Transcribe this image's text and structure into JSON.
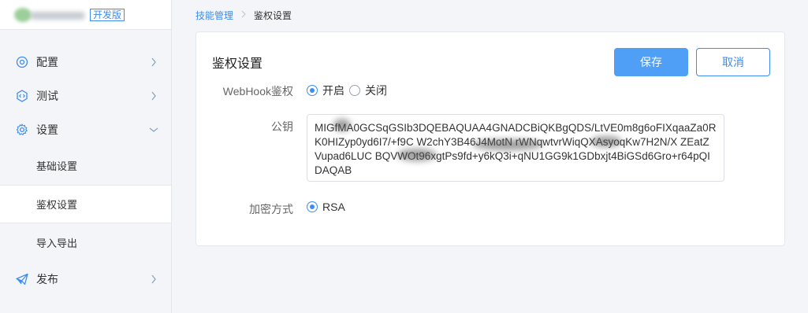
{
  "app": {
    "dev_tag": "开发版"
  },
  "sidebar": {
    "items": [
      {
        "label": "配置",
        "icon": "settings-dial-icon"
      },
      {
        "label": "测试",
        "icon": "code-shield-icon"
      },
      {
        "label": "设置",
        "icon": "gear-icon",
        "expanded": true,
        "children": [
          "基础设置",
          "鉴权设置",
          "导入导出"
        ],
        "active_child": "鉴权设置"
      },
      {
        "label": "发布",
        "icon": "paper-plane-icon"
      }
    ]
  },
  "breadcrumb": {
    "parent": "技能管理",
    "current": "鉴权设置"
  },
  "form": {
    "title": "鉴权设置",
    "save_label": "保存",
    "cancel_label": "取消",
    "webhook": {
      "label": "WebHook鉴权",
      "options": [
        "开启",
        "关闭"
      ],
      "selected": "开启"
    },
    "public_key": {
      "label": "公钥",
      "value": "MIGfMA0GCSqGSIb3DQEBAQUAA4GNADCBiQKBgQDS/LtVE0m8g6oFIXqaaZa0RK0HIZyp0yd6I7/+f9C  W2chY3B46J4MotN  rWNqwtvrWiqQXAsyoqKw7H2N/X    ZEatZ  Vupad6LUC   BQVWOt96xgtPs9fd+y6kQ3i+qNU1GG9k1GDbxjt4BiGSd6Gro+r64pQIDAQAB"
    },
    "encryption": {
      "label": "加密方式",
      "options": [
        "RSA"
      ],
      "selected": "RSA"
    }
  },
  "colors": {
    "accent": "#3d8cf0",
    "save_bg": "#4e9ff5",
    "page_bg": "#f3f5f9"
  }
}
